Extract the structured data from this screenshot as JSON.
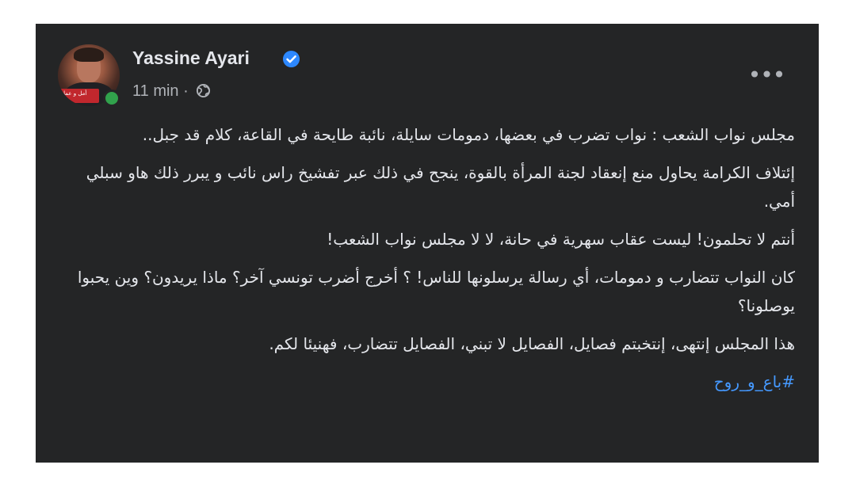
{
  "post": {
    "author": "Yassine Ayari",
    "verified": true,
    "time": "11 min",
    "separator": "·",
    "audience_icon": "globe-icon",
    "more_icon": "more-options-icon",
    "more_label": "•••",
    "avatar_banner": "أمل و عمل",
    "paragraphs": [
      "مجلس نواب الشعب : نواب تضرب في بعضها، دمومات سايلة، نائبة طايحة في القاعة، كلام قد جبل..",
      "إئتلاف الكرامة يحاول منع إنعقاد لجنة المرأة بالقوة، ينجح في ذلك عبر تفشيخ راس نائب و يبرر ذلك هاو سبلي أمي.",
      "أنتم لا تحلمون! ليست عقاب سهرية في حانة، لا لا مجلس نواب الشعب!",
      "كان النواب تتضارب و دمومات، أي رسالة يرسلونها للناس! ؟ أخرج أضرب تونسي آخر؟ ماذا يريدون؟ وين يحبوا يوصلونا؟",
      "هذا المجلس إنتهى، إنتخبتم فصايل، الفصايل لا تبني، الفصايل تتضارب، فهنيئا لكم."
    ],
    "hashtag": "#باع_و_روح"
  },
  "colors": {
    "card_background": "#242526",
    "text_primary": "#e4e6eb",
    "text_secondary": "#b0b3b8",
    "link": "#4599ff",
    "verified": "#2d88ff",
    "online": "#31a24c"
  }
}
